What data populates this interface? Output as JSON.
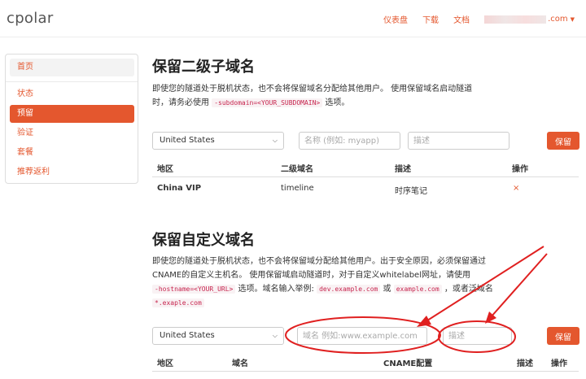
{
  "brand": "cpolar",
  "nav": {
    "dashboard": "仪表盘",
    "download": "下载",
    "docs": "文档",
    "user_suffix": ".com"
  },
  "sidebar": {
    "home": "首页",
    "items": [
      {
        "label": "状态"
      },
      {
        "label": "预留"
      },
      {
        "label": "验证"
      },
      {
        "label": "套餐"
      },
      {
        "label": "推荐返利"
      }
    ]
  },
  "subdomain_section": {
    "title": "保留二级子域名",
    "desc_part1": "即使您的隧道处于脱机状态，也不会将保留域名分配给其他用户。 使用保留域名启动隧道",
    "desc_part2": "时，请务必使用",
    "desc_code": "-subdomain=<YOUR_SUBDOMAIN>",
    "desc_part3": "选项。",
    "region_selected": "United States",
    "name_placeholder": "名称 (例如: myapp)",
    "desc_placeholder": "描述",
    "reserve_label": "保留",
    "table": {
      "headers": [
        "地区",
        "二级域名",
        "描述",
        "操作"
      ],
      "rows": [
        {
          "region": "China VIP",
          "subdomain": "timeline",
          "description": "时序笔记",
          "delete": "×"
        }
      ]
    }
  },
  "custom_section": {
    "title": "保留自定义域名",
    "desc_line1": "即使您的隧道处于脱机状态，也不会将保留域分配给其他用户。出于安全原因，必须保留通过",
    "desc_line2": "CNAME的自定义主机名。 使用保留域启动隧道时，对于自定义whitelabel网址，请使用",
    "desc_code1": "-hostname=<YOUR_URL>",
    "desc_mid1": "选项。域名输入举例:",
    "desc_code2": "dev.example.com",
    "desc_mid2": "或",
    "desc_code3": "example.com",
    "desc_mid3": "，或者泛域名",
    "desc_code4": "*.exaple.com",
    "region_selected": "United States",
    "domain_placeholder": "域名 例如:www.example.com",
    "desc_placeholder": "描述",
    "reserve_label": "保留",
    "table": {
      "headers": [
        "地区",
        "域名",
        "CNAME配置",
        "描述",
        "操作"
      ]
    }
  },
  "colors": {
    "accent": "#e4572e",
    "annotation": "#e02020"
  }
}
